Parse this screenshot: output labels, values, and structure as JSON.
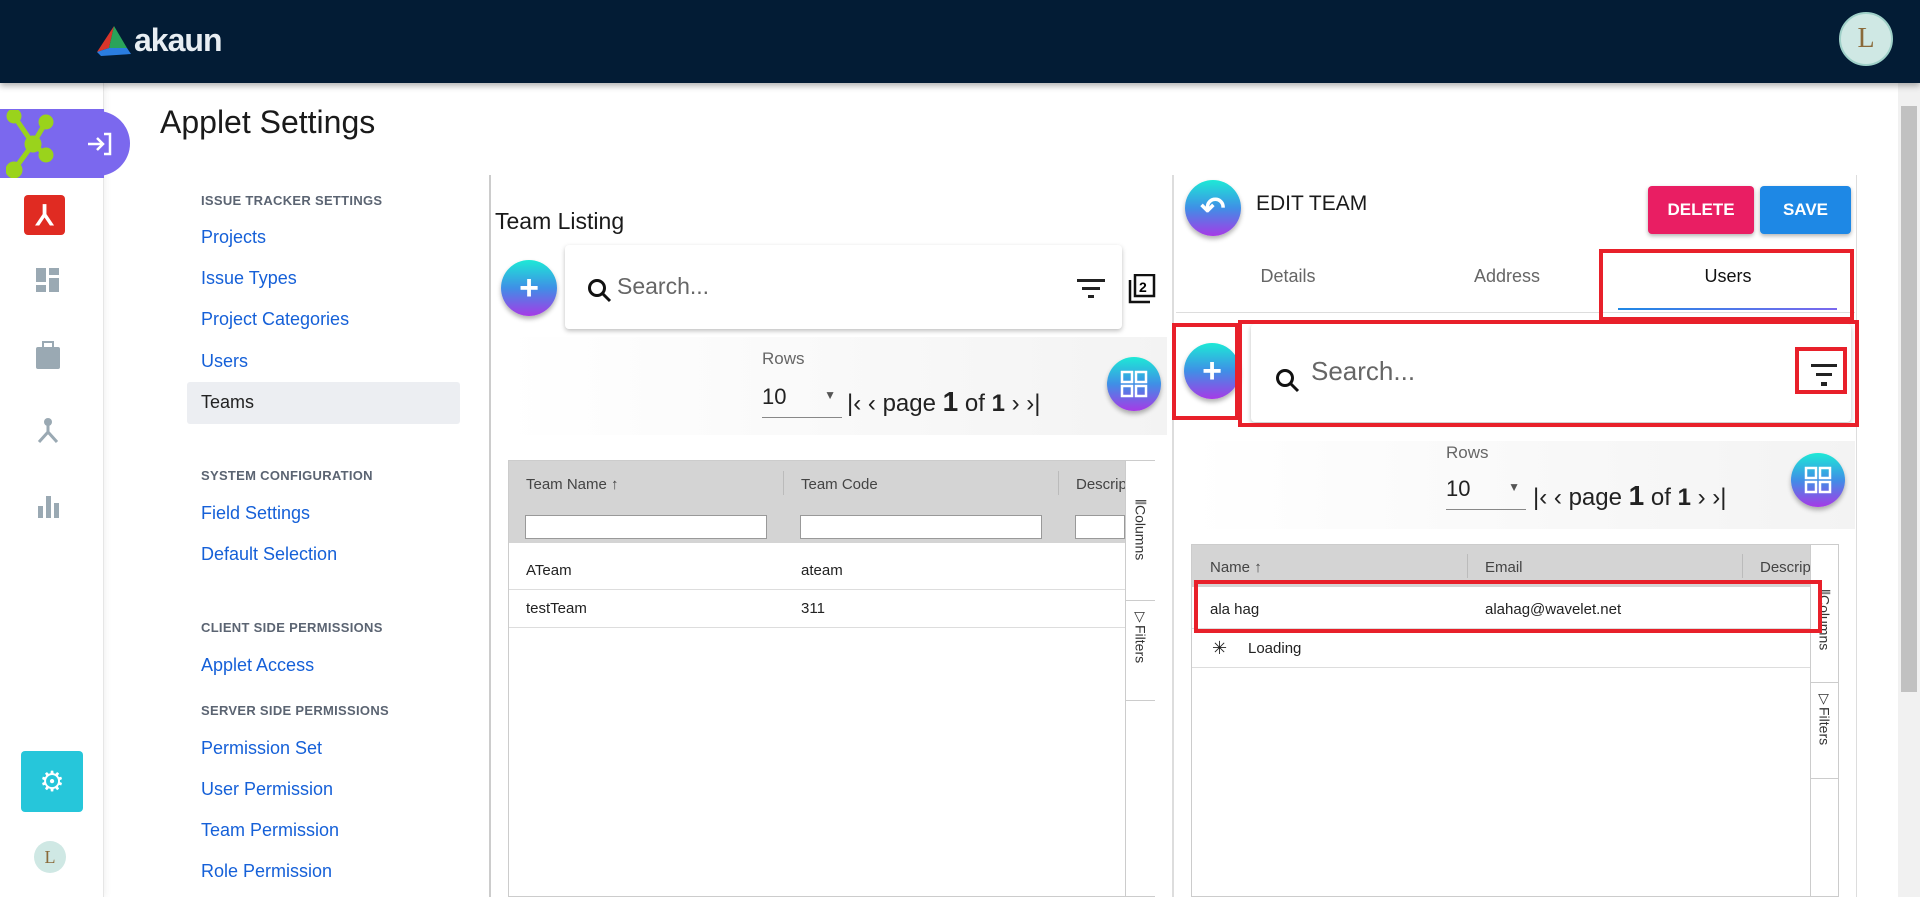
{
  "header": {
    "brand": "akaun",
    "user_avatar": "L"
  },
  "rail": {
    "items": [
      "applet-network-icon",
      "red-app-icon",
      "dashboard-icon",
      "bag-icon",
      "hierarchy-icon",
      "bar-chart-icon",
      "settings-icon",
      "avatar"
    ],
    "avatar": "L"
  },
  "page_title": "Applet Settings",
  "settings_nav": {
    "sections": [
      {
        "title": "ISSUE TRACKER SETTINGS",
        "items": [
          "Projects",
          "Issue Types",
          "Project Categories",
          "Users",
          "Teams"
        ]
      },
      {
        "title": "SYSTEM CONFIGURATION",
        "items": [
          "Field Settings",
          "Default Selection"
        ]
      },
      {
        "title": "CLIENT SIDE PERMISSIONS",
        "items": [
          "Applet Access"
        ]
      },
      {
        "title": "SERVER SIDE PERMISSIONS",
        "items": [
          "Permission Set",
          "User Permission",
          "Team Permission",
          "Role Permission"
        ]
      }
    ],
    "active": "Teams"
  },
  "team_listing": {
    "title": "Team Listing",
    "search_placeholder": "Search...",
    "rows_label": "Rows",
    "rows_value": "10",
    "pager": {
      "page_word": "page",
      "page": "1",
      "of_word": "of",
      "total": "1"
    },
    "columns": [
      "Team Name",
      "Team Code",
      "Descrip"
    ],
    "rows": [
      {
        "name": "ATeam",
        "code": "ateam"
      },
      {
        "name": "testTeam",
        "code": "311"
      }
    ],
    "side_tabs": [
      "Columns",
      "Filters"
    ]
  },
  "edit_team": {
    "title": "EDIT TEAM",
    "delete_label": "DELETE",
    "save_label": "SAVE",
    "tabs": [
      "Details",
      "Address",
      "Users"
    ],
    "active_tab": "Users",
    "search_placeholder": "Search...",
    "rows_label": "Rows",
    "rows_value": "10",
    "pager": {
      "page_word": "page",
      "page": "1",
      "of_word": "of",
      "total": "1"
    },
    "columns": [
      "Name",
      "Email",
      "Descrip"
    ],
    "rows": [
      {
        "name": "ala hag",
        "email": "alahag@wavelet.net"
      }
    ],
    "loading": "Loading",
    "side_tabs": [
      "Columns",
      "Filters"
    ]
  },
  "colors": {
    "topbar": "#031c35",
    "accent_purple": "#7b68ee",
    "delete": "#e91e63",
    "save": "#1e88e5",
    "link": "#1560d8",
    "highlight": "#e8202a"
  }
}
